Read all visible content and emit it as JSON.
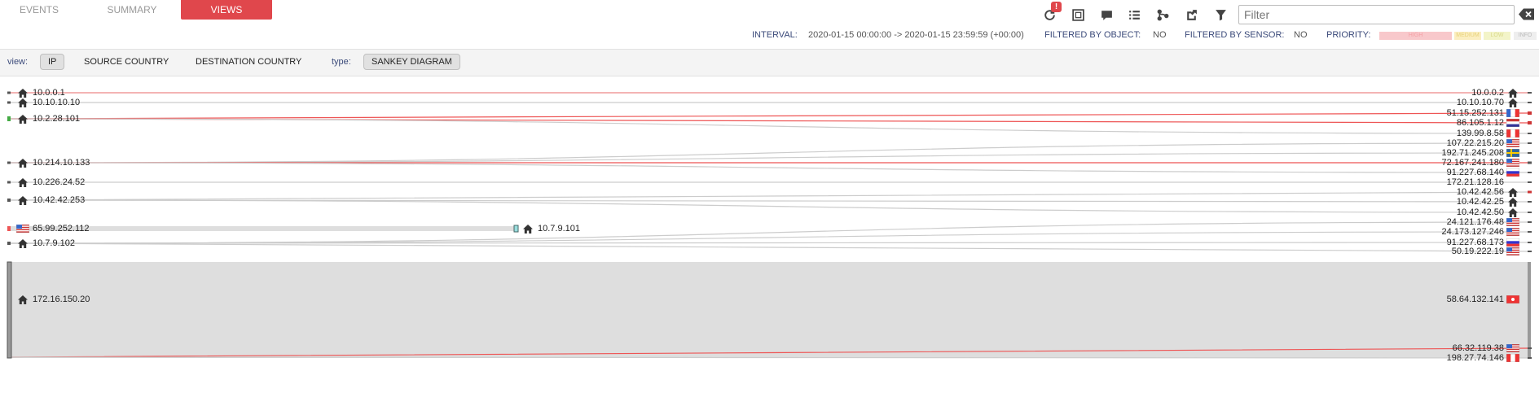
{
  "tabs": [
    {
      "label": "EVENTS",
      "active": false
    },
    {
      "label": "SUMMARY",
      "active": false
    },
    {
      "label": "VIEWS",
      "active": true
    }
  ],
  "toolbar": {
    "icons": [
      "refresh-icon",
      "fullscreen-icon",
      "comment-icon",
      "list-icon",
      "share-nodes-icon",
      "external-link-icon",
      "filter-icon"
    ],
    "refresh_badge": "!",
    "filter_placeholder": "Filter",
    "filter_value": ""
  },
  "status": {
    "interval_label": "INTERVAL:",
    "interval_value": "2020-01-15 00:00:00 -> 2020-01-15 23:59:59 (+00:00)",
    "filtered_object_label": "FILTERED BY OBJECT:",
    "filtered_object_value": "NO",
    "filtered_sensor_label": "FILTERED BY SENSOR:",
    "filtered_sensor_value": "NO",
    "priority_label": "PRIORITY:",
    "priority_levels": [
      {
        "label": "HIGH",
        "color": "#f8c8cb"
      },
      {
        "label": "MEDIUM",
        "color": "#fbeec0"
      },
      {
        "label": "LOW",
        "color": "#f3f4c8"
      },
      {
        "label": "INFO",
        "color": "#eeeeee"
      }
    ]
  },
  "viewbar": {
    "view_label": "view:",
    "views": [
      {
        "label": "IP",
        "active": true
      },
      {
        "label": "SOURCE COUNTRY",
        "active": false
      },
      {
        "label": "DESTINATION COUNTRY",
        "active": false
      }
    ],
    "type_label": "type:",
    "type_value": "SANKEY DIAGRAM"
  },
  "sankey": {
    "sources": [
      {
        "ip": "10.0.0.1",
        "icon": "home"
      },
      {
        "ip": "10.10.10.10",
        "icon": "home"
      },
      {
        "ip": "10.2.28.101",
        "icon": "home"
      },
      {
        "ip": "10.214.10.133",
        "icon": "home"
      },
      {
        "ip": "10.226.24.52",
        "icon": "home"
      },
      {
        "ip": "10.42.42.253",
        "icon": "home"
      },
      {
        "ip": "65.99.252.112",
        "icon": "us-flag"
      },
      {
        "ip": "10.7.9.102",
        "icon": "home"
      },
      {
        "ip": "172.16.150.20",
        "icon": "home"
      }
    ],
    "middle": [
      {
        "ip": "10.7.9.101",
        "icon": "home"
      }
    ],
    "targets": [
      {
        "ip": "10.0.0.2",
        "icon": "home"
      },
      {
        "ip": "10.10.10.70",
        "icon": "home"
      },
      {
        "ip": "51.15.252.131",
        "icon": "fr-flag"
      },
      {
        "ip": "86.105.1.12",
        "icon": "nl-flag"
      },
      {
        "ip": "139.99.8.58",
        "icon": "ca-flag"
      },
      {
        "ip": "107.22.215.20",
        "icon": "us-flag"
      },
      {
        "ip": "192.71.245.208",
        "icon": "se-flag"
      },
      {
        "ip": "72.167.241.180",
        "icon": "us-flag"
      },
      {
        "ip": "91.227.68.140",
        "icon": "ru-flag"
      },
      {
        "ip": "172.21.128.16",
        "icon": "none"
      },
      {
        "ip": "10.42.42.56",
        "icon": "home"
      },
      {
        "ip": "10.42.42.25",
        "icon": "home"
      },
      {
        "ip": "10.42.42.50",
        "icon": "home"
      },
      {
        "ip": "24.121.176.48",
        "icon": "us-flag"
      },
      {
        "ip": "24.173.127.246",
        "icon": "us-flag"
      },
      {
        "ip": "91.227.68.173",
        "icon": "ru-flag"
      },
      {
        "ip": "50.19.222.19",
        "icon": "us-flag"
      },
      {
        "ip": "58.64.132.141",
        "icon": "hk-flag"
      },
      {
        "ip": "66.32.119.38",
        "icon": "us-flag"
      },
      {
        "ip": "198.27.74.146",
        "icon": "ca-flag"
      }
    ],
    "links": [
      {
        "source": "10.0.0.1",
        "target": "10.0.0.2",
        "color": "#e88"
      },
      {
        "source": "10.10.10.10",
        "target": "10.10.10.70",
        "color": "#ccc"
      },
      {
        "source": "10.2.28.101",
        "target": "51.15.252.131",
        "color": "#e55"
      },
      {
        "source": "10.2.28.101",
        "target": "86.105.1.12",
        "color": "#e55"
      },
      {
        "source": "10.2.28.101",
        "target": "139.99.8.58",
        "color": "#ccc"
      },
      {
        "source": "10.214.10.133",
        "target": "107.22.215.20",
        "color": "#ccc"
      },
      {
        "source": "10.214.10.133",
        "target": "192.71.245.208",
        "color": "#ccc"
      },
      {
        "source": "10.214.10.133",
        "target": "72.167.241.180",
        "color": "#e55"
      },
      {
        "source": "10.214.10.133",
        "target": "91.227.68.140",
        "color": "#ccc"
      },
      {
        "source": "10.226.24.52",
        "target": "172.21.128.16",
        "color": "#ccc"
      },
      {
        "source": "10.42.42.253",
        "target": "10.42.42.56",
        "color": "#ccc"
      },
      {
        "source": "10.42.42.253",
        "target": "10.42.42.25",
        "color": "#ccc"
      },
      {
        "source": "10.42.42.253",
        "target": "10.42.42.50",
        "color": "#ccc"
      },
      {
        "source": "65.99.252.112",
        "target": "10.7.9.101",
        "color": "#ddd"
      },
      {
        "source": "10.7.9.102",
        "target": "24.121.176.48",
        "color": "#ccc"
      },
      {
        "source": "10.7.9.102",
        "target": "24.173.127.246",
        "color": "#ccc"
      },
      {
        "source": "10.7.9.102",
        "target": "91.227.68.173",
        "color": "#ccc"
      },
      {
        "source": "10.7.9.102",
        "target": "50.19.222.19",
        "color": "#ccc"
      },
      {
        "source": "172.16.150.20",
        "target": "58.64.132.141",
        "color": "#ddd"
      },
      {
        "source": "172.16.150.20",
        "target": "66.32.119.38",
        "color": "#e55"
      },
      {
        "source": "172.16.150.20",
        "target": "198.27.74.146",
        "color": "#ccc"
      }
    ]
  }
}
